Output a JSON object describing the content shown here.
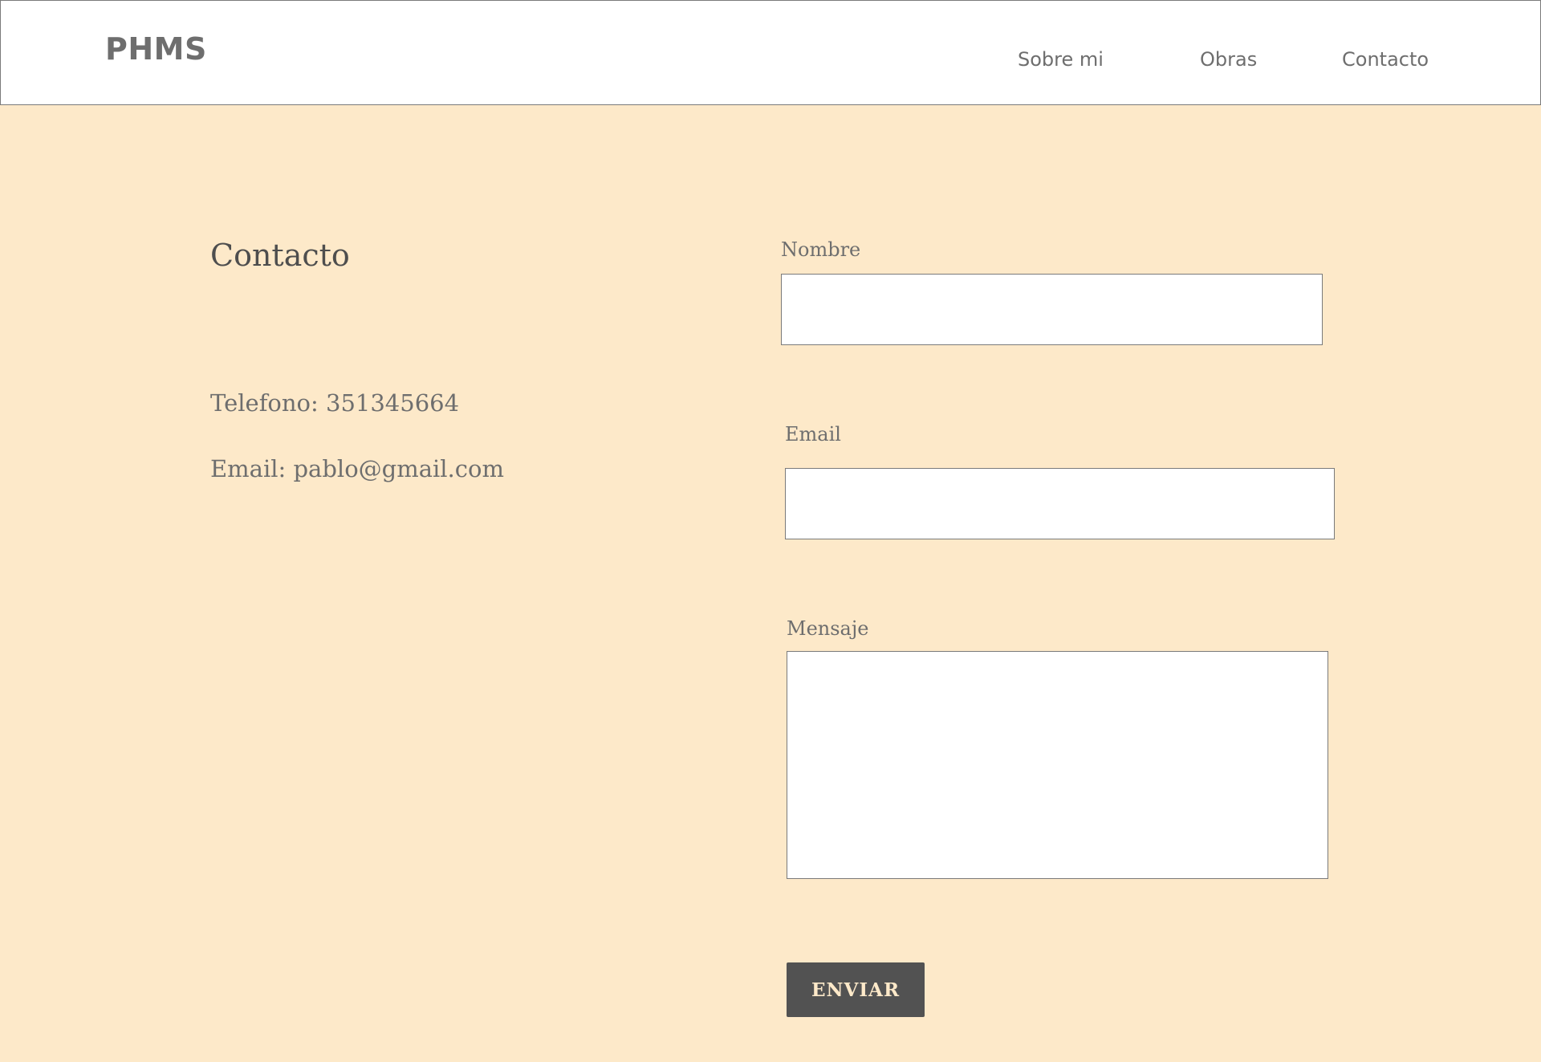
{
  "header": {
    "brand": "PHMS",
    "nav": {
      "about": "Sobre mi",
      "works": "Obras",
      "contact": "Contacto"
    }
  },
  "contact": {
    "title": "Contacto",
    "phone": "Telefono: 351345664",
    "email": "Email: pablo@gmail.com"
  },
  "form": {
    "name_label": "Nombre",
    "name_value": "",
    "email_label": "Email",
    "email_value": "",
    "message_label": "Mensaje",
    "message_value": "",
    "submit_label": "ENVIAR"
  },
  "colors": {
    "page_background": "#fde9c9",
    "header_background": "#ffffff",
    "button_background": "#525252",
    "button_text": "#fde9c9",
    "text": "#6e6e6e"
  }
}
